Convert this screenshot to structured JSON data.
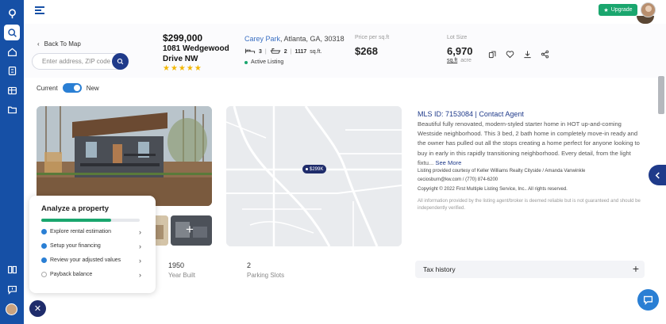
{
  "header": {
    "upgrade_label": "Upgrade",
    "back_label": "Back To Map",
    "search_placeholder": "Enter address, ZIP code",
    "toggle_left": "Current",
    "toggle_right": "New"
  },
  "listing": {
    "price": "$299,000",
    "address": "1081 Wedgewood Drive NW",
    "stars": "★★★★★",
    "neighborhood": "Carey Park",
    "city_line": ", Atlanta, GA, 30318",
    "beds": "3",
    "baths": "2",
    "sqft": "1117",
    "sqft_unit": "sq.ft.",
    "status": "Active Listing",
    "ppsf_label": "Price per sq.ft",
    "ppsf": "$268",
    "lot_label": "Lot Size",
    "lot_value": "6,970",
    "lot_unit": "sq.ft",
    "lot_unit_alt": "acre"
  },
  "map": {
    "pin_label": "$299K"
  },
  "details": {
    "mls_line": "MLS ID: 7153084 | Contact Agent",
    "description": "Beautiful fully renovated, modern-styled starter home in HOT up-and-coming Westside neighborhood. This 3 bed, 2 bath home in completely move-in ready and the owner has pulled out all the stops creating a home perfect for anyone looking to buy in early in this rapidly transitioning neighborhood. Every detail, from the light fixtu...",
    "see_more": "See More",
    "courtesy": "Listing provided courtesy of Keller Williams Realty Cityside / Amanda Vanwinkle",
    "contact": "ceciosburn@kw.com / (770) 874-6200",
    "copyright": "Copyright © 2022 First Multiple Listing Service, Inc.. All rights reserved.",
    "disclaimer": "All information provided by the listing agent/broker is deemed reliable but is not guaranteed and should be independently verified."
  },
  "stats": [
    {
      "value": "1950",
      "label": "Year Built"
    },
    {
      "value": "2",
      "label": "Parking Slots"
    }
  ],
  "tax_history_label": "Tax history",
  "analyze": {
    "title": "Analyze a property",
    "progress": 0.71,
    "items": [
      {
        "label": "Explore rental estimation",
        "done": true
      },
      {
        "label": "Setup your financing",
        "done": true
      },
      {
        "label": "Review your adjusted values",
        "done": true
      },
      {
        "label": "Payback balance",
        "done": false
      }
    ]
  },
  "thumb_more_label": "+",
  "icons": [
    "logo-icon",
    "search-icon",
    "home-icon",
    "calculator-icon",
    "table-icon",
    "folder-icon",
    "book-icon",
    "feedback-icon",
    "compare-icon",
    "heart-icon",
    "download-icon",
    "share-icon",
    "chat-icon"
  ],
  "colors": {
    "sidebar": "#1650a6",
    "accent": "#1f3a8a",
    "green": "#1aa66e",
    "link": "#3a6fc2"
  }
}
